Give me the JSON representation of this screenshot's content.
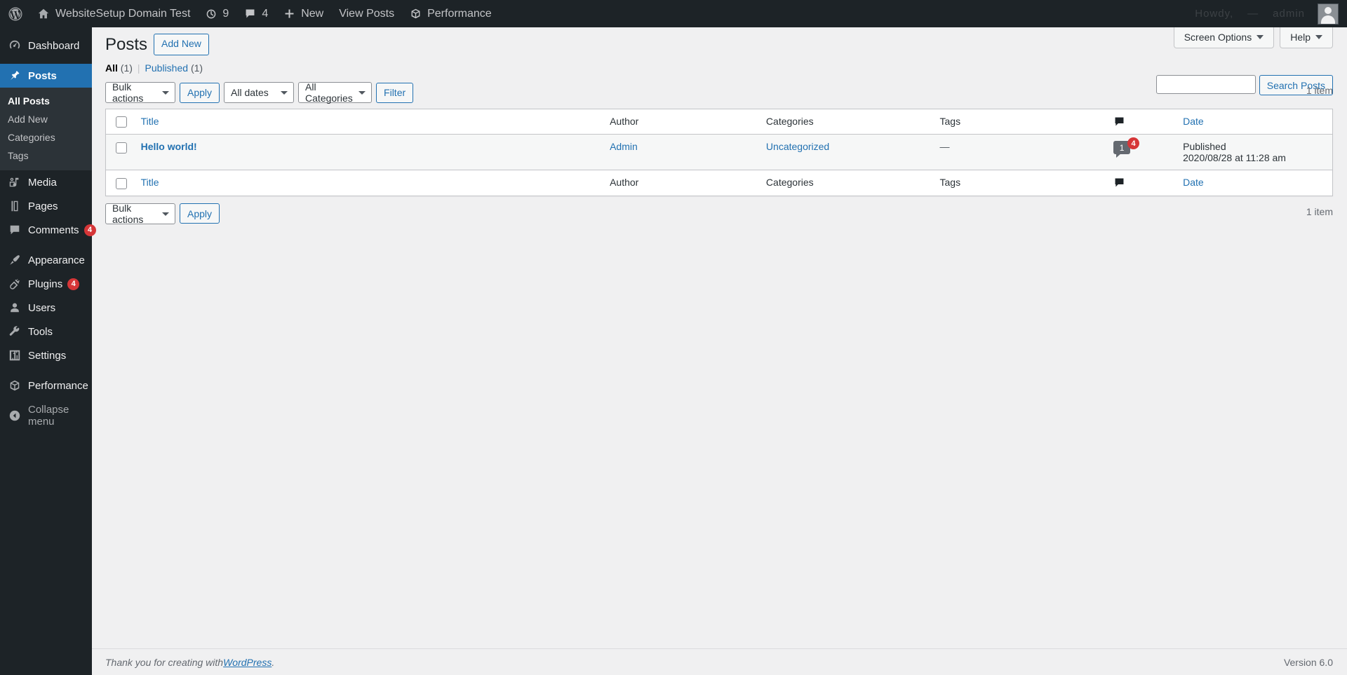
{
  "adminbar": {
    "logo_icon": "wordpress-logo-icon",
    "site": {
      "label": "WebsiteSetup Domain Test",
      "icon": "home-icon"
    },
    "updates": {
      "label": "9",
      "icon": "updates-icon"
    },
    "comments": {
      "label": "4",
      "icon": "comment-bubble-icon"
    },
    "new": {
      "label": "New",
      "icon": "plus-icon"
    },
    "view_posts": {
      "label": "View Posts"
    },
    "performance": {
      "label": "Performance",
      "icon": "cube-icon"
    },
    "ghost_right": [
      "Howdy,",
      "—",
      "admin"
    ],
    "avatar_alt": "user-avatar"
  },
  "sidebar": {
    "items": [
      {
        "label": "Dashboard",
        "icon": "dashboard-gauge-icon",
        "name": "dashboard",
        "current": false,
        "badge": ""
      },
      {
        "label": "Posts",
        "icon": "pin-icon",
        "name": "posts",
        "current": true,
        "badge": ""
      },
      {
        "label": "Media",
        "icon": "media-icon",
        "name": "media",
        "current": false,
        "badge": ""
      },
      {
        "label": "Pages",
        "icon": "pages-icon",
        "name": "pages",
        "current": false,
        "badge": ""
      },
      {
        "label": "Comments",
        "icon": "comment-bubble-icon",
        "name": "comments",
        "current": false,
        "badge": "4"
      },
      {
        "label": "Appearance",
        "icon": "paintbrush-icon",
        "name": "appearance",
        "current": false,
        "badge": ""
      },
      {
        "label": "Plugins",
        "icon": "plug-icon",
        "name": "plugins",
        "current": false,
        "badge": "4"
      },
      {
        "label": "Users",
        "icon": "user-icon",
        "name": "users",
        "current": false,
        "badge": ""
      },
      {
        "label": "Tools",
        "icon": "wrench-icon",
        "name": "tools",
        "current": false,
        "badge": ""
      },
      {
        "label": "Settings",
        "icon": "sliders-icon",
        "name": "settings",
        "current": false,
        "badge": ""
      },
      {
        "label": "Performance",
        "icon": "cube-icon",
        "name": "performance",
        "current": false,
        "badge": ""
      }
    ],
    "submenu_posts": [
      {
        "label": "All Posts",
        "current": true
      },
      {
        "label": "Add New",
        "current": false
      },
      {
        "label": "Categories",
        "current": false
      },
      {
        "label": "Tags",
        "current": false
      }
    ],
    "collapse": {
      "label": "Collapse menu",
      "icon": "chevron-left-circle-icon"
    }
  },
  "screen_meta": {
    "screen_options": "Screen Options",
    "help": "Help"
  },
  "page": {
    "title": "Posts",
    "add_new": "Add New"
  },
  "views": {
    "all": {
      "label": "All",
      "count": "(1)"
    },
    "published": {
      "label": "Published",
      "count": "(1)"
    },
    "separator": "|"
  },
  "search": {
    "value": "",
    "placeholder": "",
    "button": "Search Posts"
  },
  "tablenav_top": {
    "bulk_actions": "Bulk actions",
    "apply": "Apply",
    "all_dates": "All dates",
    "all_categories": "All Categories",
    "filter": "Filter",
    "displaying_num": "1 item"
  },
  "tablenav_bottom": {
    "bulk_actions": "Bulk actions",
    "apply": "Apply",
    "displaying_num": "1 item"
  },
  "table": {
    "columns": {
      "title": "Title",
      "author": "Author",
      "categories": "Categories",
      "tags": "Tags",
      "comments": "comment-bubble-icon",
      "date": "Date"
    },
    "rows": [
      {
        "title": "Hello world!",
        "author": "Admin",
        "categories": "Uncategorized",
        "tags": "—",
        "comment_count": "1",
        "comment_pending": "4",
        "date_status": "Published",
        "date_value": "2020/08/28 at 11:28 am"
      }
    ]
  },
  "footer": {
    "thanks_prefix": "Thank you for creating with ",
    "wordpress_link": "WordPress",
    "thanks_suffix": ".",
    "version": "Version 6.0"
  },
  "colors": {
    "admin_bg": "#1d2327",
    "submenu_bg": "#2c3338",
    "accent": "#2271b1",
    "link": "#2271b1",
    "badge_red": "#d63638",
    "content_bg": "#f0f0f1",
    "table_bg": "#ffffff",
    "alt_row": "#f6f7f7"
  }
}
